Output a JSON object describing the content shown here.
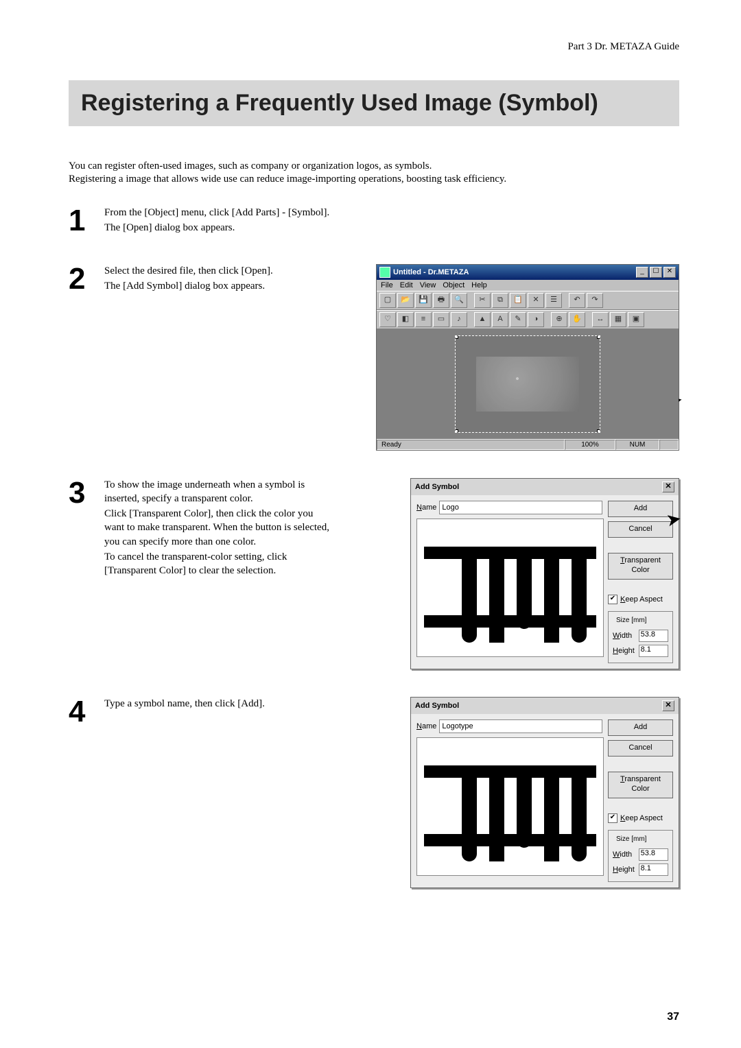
{
  "running_head": "Part 3  Dr. METAZA Guide",
  "page_title": "Registering a Frequently Used Image (Symbol)",
  "intro": {
    "line1": "You can register often-used images, such as company or organization logos, as symbols.",
    "line2": "Registering a image that allows wide use can reduce image-importing operations, boosting task efficiency."
  },
  "steps": {
    "s1": {
      "num": "1",
      "l1": "From the [Object] menu, click [Add Parts] - [Symbol].",
      "l2": "The [Open] dialog box appears."
    },
    "s2": {
      "num": "2",
      "l1": "Select the desired file, then click [Open].",
      "l2": "The [Add Symbol] dialog box appears."
    },
    "s3": {
      "num": "3",
      "l1": "To show the image underneath when a symbol is inserted, specify a transparent color.",
      "l2": "Click [Transparent Color], then click the color you want to make transparent. When the button is selected, you can specify more than one color.",
      "l3": "To cancel the transparent-color setting, click [Transparent Color] to clear the selection."
    },
    "s4": {
      "num": "4",
      "l1": "Type a symbol name, then click [Add]."
    }
  },
  "app_window": {
    "title": "Untitled - Dr.METAZA",
    "menu": {
      "file": "File",
      "edit": "Edit",
      "view": "View",
      "object": "Object",
      "help": "Help"
    },
    "status": {
      "ready": "Ready",
      "zoom": "100%",
      "num": "NUM"
    }
  },
  "dialog": {
    "title": "Add Symbol",
    "name_label_prefix": "N",
    "name_label_rest": "ame",
    "add_label": "Add",
    "cancel_label": "Cancel",
    "trans_label_prefix": "T",
    "trans_label_rest": "ransparent\nColor",
    "keep_prefix": "K",
    "keep_rest": "eep Aspect",
    "size_legend": "Size [mm]",
    "width_prefix": "W",
    "width_rest": "idth",
    "width_val": "53.8",
    "height_prefix": "H",
    "height_rest": "eight",
    "height_val": "8.1",
    "name_value_step3": "Logo",
    "name_value_step4": "Logotype"
  },
  "page_number": "37"
}
